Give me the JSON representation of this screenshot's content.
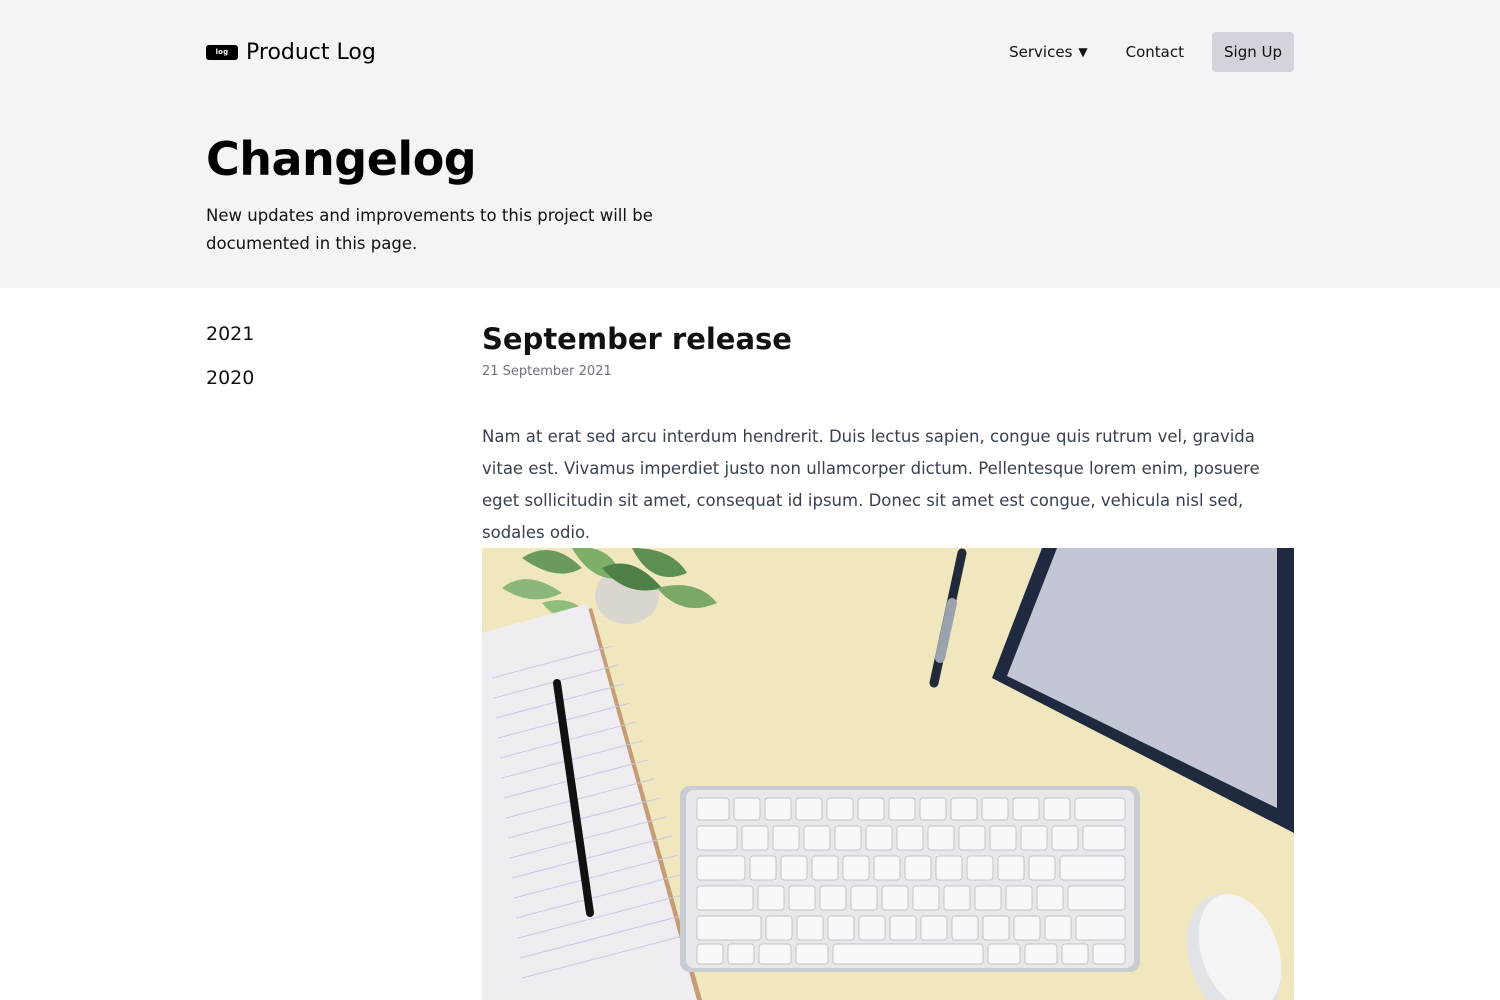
{
  "header": {
    "logo_badge": "log",
    "brand": "Product Log",
    "nav": {
      "services": "Services",
      "services_caret": "▼",
      "contact": "Contact",
      "signup": "Sign Up"
    }
  },
  "hero": {
    "title": "Changelog",
    "subtitle": "New updates and improvements to this project will be documented in this page."
  },
  "sidebar": {
    "years": [
      "2021",
      "2020"
    ]
  },
  "release": {
    "title": "September release",
    "date": "21 September 2021",
    "body": "Nam at erat sed arcu interdum hendrerit. Duis lectus sapien, congue quis rutrum vel, gravida vitae est. Vivamus imperdiet justo non ullamcorper dictum. Pellentesque lorem enim, posuere eget sollicitudin sit amet, consequat id ipsum. Donec sit amet est congue, vehicula nisl sed, sodales odio."
  }
}
